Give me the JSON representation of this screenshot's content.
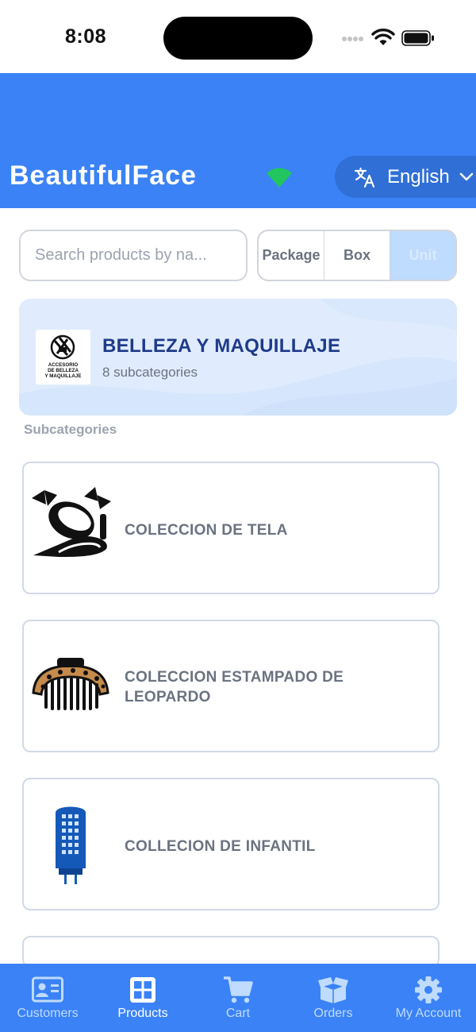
{
  "status_bar": {
    "time": "8:08"
  },
  "header": {
    "brand": "BeautifulFace",
    "language": "English"
  },
  "search": {
    "placeholder": "Search products by na..."
  },
  "unit_toggle": {
    "options": [
      "Package",
      "Box",
      "Unit"
    ],
    "selected": "Unit"
  },
  "category": {
    "title": "BELLEZA Y MAQUILLAJE",
    "subcategory_count": "8 subcategories",
    "logo_text": "ACCESORIO DE BELLEZA Y MAQUILLAJE"
  },
  "section_label": "Subcategories",
  "subcategories": [
    {
      "name": "COLECCION DE TELA",
      "icon": "bow-hair-accessories-icon"
    },
    {
      "name": "COLECCION ESTAMPADO DE LEOPARDO",
      "icon": "leopard-claw-clip-icon"
    },
    {
      "name": "COLLECION DE INFANTIL",
      "icon": "blue-device-icon"
    }
  ],
  "bottom_nav": {
    "items": [
      {
        "label": "Customers",
        "icon": "contact-card-icon",
        "active": false
      },
      {
        "label": "Products",
        "icon": "grid-icon",
        "active": true
      },
      {
        "label": "Cart",
        "icon": "cart-icon",
        "active": false
      },
      {
        "label": "Orders",
        "icon": "box-icon",
        "active": false
      },
      {
        "label": "My Account",
        "icon": "gear-icon",
        "active": false
      }
    ]
  },
  "colors": {
    "primary": "#3b82f6",
    "card_background": "#e0ecfd",
    "title_dark_blue": "#1e3a8a",
    "online_indicator": "#22c55e"
  }
}
